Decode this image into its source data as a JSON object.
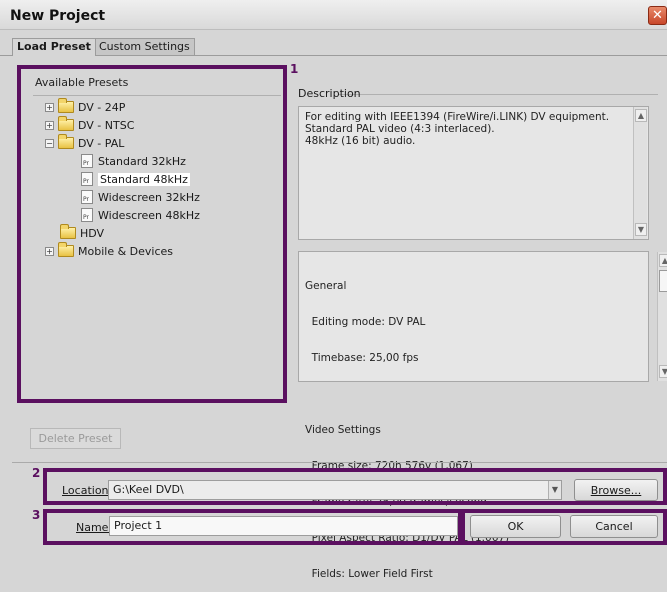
{
  "window": {
    "title": "New Project",
    "close_glyph": "✕"
  },
  "tabs": [
    {
      "label": "Load Preset",
      "active": true
    },
    {
      "label": "Custom Settings",
      "active": false
    }
  ],
  "presets": {
    "label": "Available Presets",
    "items": [
      {
        "label": "DV - 24P",
        "type": "folder",
        "expander": "+"
      },
      {
        "label": "DV - NTSC",
        "type": "folder",
        "expander": "+"
      },
      {
        "label": "DV - PAL",
        "type": "folder",
        "expander": "−"
      },
      {
        "label": "Standard 32kHz",
        "type": "preset"
      },
      {
        "label": "Standard 48kHz",
        "type": "preset",
        "selected": true
      },
      {
        "label": "Widescreen 32kHz",
        "type": "preset"
      },
      {
        "label": "Widescreen 48kHz",
        "type": "preset"
      },
      {
        "label": "HDV",
        "type": "folder"
      },
      {
        "label": "Mobile & Devices",
        "type": "folder",
        "expander": "+"
      }
    ],
    "file_badge": "Pr"
  },
  "description": {
    "label": "Description",
    "lines": [
      "For editing with IEEE1394 (FireWire/i.LINK) DV equipment.",
      "Standard PAL video (4:3 interlaced).",
      "48kHz (16 bit) audio."
    ]
  },
  "info": {
    "lines": [
      "General",
      "  Editing mode: DV PAL",
      "  Timebase: 25,00 fps",
      "",
      "Video Settings",
      "  Frame size: 720h 576v (1,067)",
      "  Frame rate: 25,00 frames/second",
      "  Pixel Aspect Ratio: D1/DV PAL (1.067)",
      "  Fields: Lower Field First"
    ]
  },
  "buttons": {
    "delete_preset": "Delete Preset",
    "browse": "Browse...",
    "ok": "OK",
    "cancel": "Cancel"
  },
  "location": {
    "label": "Location:",
    "value": "G:\\Keel DVD\\"
  },
  "name": {
    "label": "Name:",
    "value": "Project 1"
  },
  "annotations": [
    "1",
    "2",
    "3"
  ],
  "colors": {
    "highlight_border": "#5b1060"
  }
}
